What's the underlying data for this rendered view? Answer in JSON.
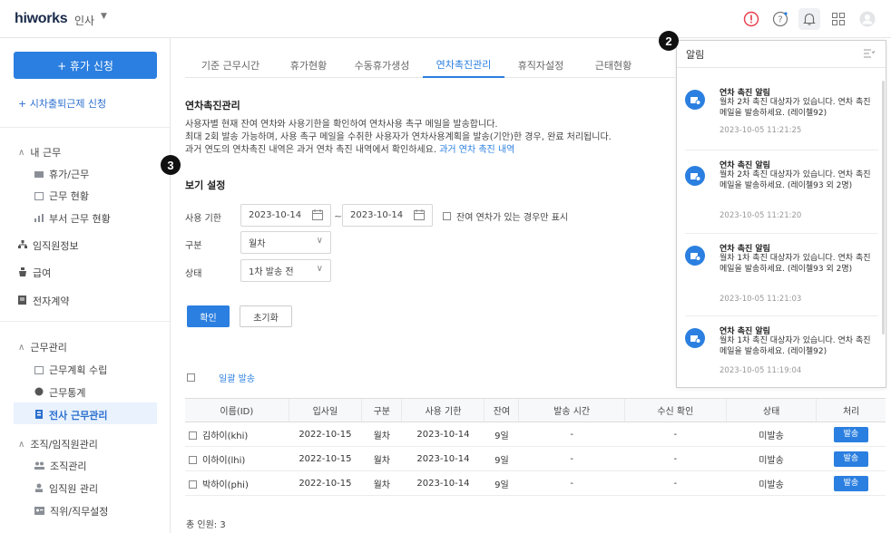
{
  "header": {
    "logo": "hiworks",
    "app": "인사",
    "icons": [
      "alert-icon",
      "help-icon",
      "bell-icon",
      "apps-grid-icon",
      "user-avatar-icon"
    ],
    "alert_color": "#e63946"
  },
  "sidebar": {
    "vacation_button": "+ 휴가 신청",
    "flex_request": "+ 시차출퇴근제 신청",
    "sections": {
      "my_work": "내 근무",
      "vacation": "휴가/근무",
      "work_status": "근무 현황",
      "dept_status": "부서 근무 현황",
      "staff_info": "임직원정보",
      "salary": "급여",
      "contract": "전자계약",
      "work_mgmt": "근무관리",
      "work_plan": "근무계획 수립",
      "work_stats": "근무통계",
      "company_work": "전사 근무관리",
      "org_mgmt": "조직/임직원관리",
      "org": "조직관리",
      "staff_mgmt": "임직원 관리",
      "position": "직위/직무설정"
    }
  },
  "tabs": [
    "기준 근무시간",
    "휴가현황",
    "수동휴가생성",
    "연차촉진관리",
    "휴직자설정",
    "근태현황"
  ],
  "active_tab": "연차촉진관리",
  "page": {
    "title": "연차촉진관리",
    "desc1": "사용자별 현재 잔여 연차와 사용기한을 확인하여 연차사용 촉구 메일을 발송합니다.",
    "desc2": "최대 2회 발송 가능하며, 사용 촉구 메일을 수취한 사용자가 연차사용계획을 발송(기안)한 경우, 완료 처리됩니다.",
    "desc3_pre": "과거 연도의 연차촉진 내역은 과거 연차 촉진 내역에서 확인하세요.",
    "desc3_link": "과거 연차 촉진 내역"
  },
  "filters": {
    "title": "보기 설정",
    "period_label": "사용 기한",
    "date_from": "2023-10-14",
    "date_to": "2023-10-14",
    "remain_only": "잔여 연차가 있는 경우만 표시",
    "type_label": "구분",
    "type_value": "월차",
    "status_label": "상태",
    "status_value": "1차 발송 전",
    "confirm": "확인",
    "reset": "초기화"
  },
  "bulk_send": "일괄 발송",
  "table": {
    "headers": [
      "이름(ID)",
      "입사일",
      "구분",
      "사용 기한",
      "잔여",
      "발송 시간",
      "수신 확인",
      "상태",
      "처리"
    ],
    "rows": [
      {
        "name": "김하이(khi)",
        "join": "2022-10-15",
        "type": "월차",
        "deadline": "2023-10-14",
        "remain": "9일",
        "sent": "-",
        "read": "-",
        "status": "미발송",
        "action": "발송"
      },
      {
        "name": "이하이(lhi)",
        "join": "2022-10-15",
        "type": "월차",
        "deadline": "2023-10-14",
        "remain": "9일",
        "sent": "-",
        "read": "-",
        "status": "미발송",
        "action": "발송"
      },
      {
        "name": "박하이(phi)",
        "join": "2022-10-15",
        "type": "월차",
        "deadline": "2023-10-14",
        "remain": "9일",
        "sent": "-",
        "read": "-",
        "status": "미발송",
        "action": "발송"
      }
    ]
  },
  "total": "총 인원: 3",
  "notifications": {
    "title": "알림",
    "items": [
      {
        "title": "연차 촉진 알림",
        "body": "월차 2차 촉진 대상자가 있습니다. 연차 촉진 메일을 발송하세요. (레이첼92)",
        "time": "2023-10-05 11:21:25"
      },
      {
        "title": "연차 촉진 알림",
        "body": "월차 2차 촉진 대상자가 있습니다. 연차 촉진 메일을 발송하세요. (레이첼93 외 2명)",
        "time": "2023-10-05 11:21:20"
      },
      {
        "title": "연차 촉진 알림",
        "body": "월차 1차 촉진 대상자가 있습니다. 연차 촉진 메일을 발송하세요. (레이첼93 외 2명)",
        "time": "2023-10-05 11:21:03"
      },
      {
        "title": "연차 촉진 알림",
        "body": "월차 1차 촉진 대상자가 있습니다. 연차 촉진 메일을 발송하세요. (레이첼92)",
        "time": "2023-10-05 11:19:04"
      }
    ]
  },
  "badges": {
    "b2": "2",
    "b3": "3"
  }
}
